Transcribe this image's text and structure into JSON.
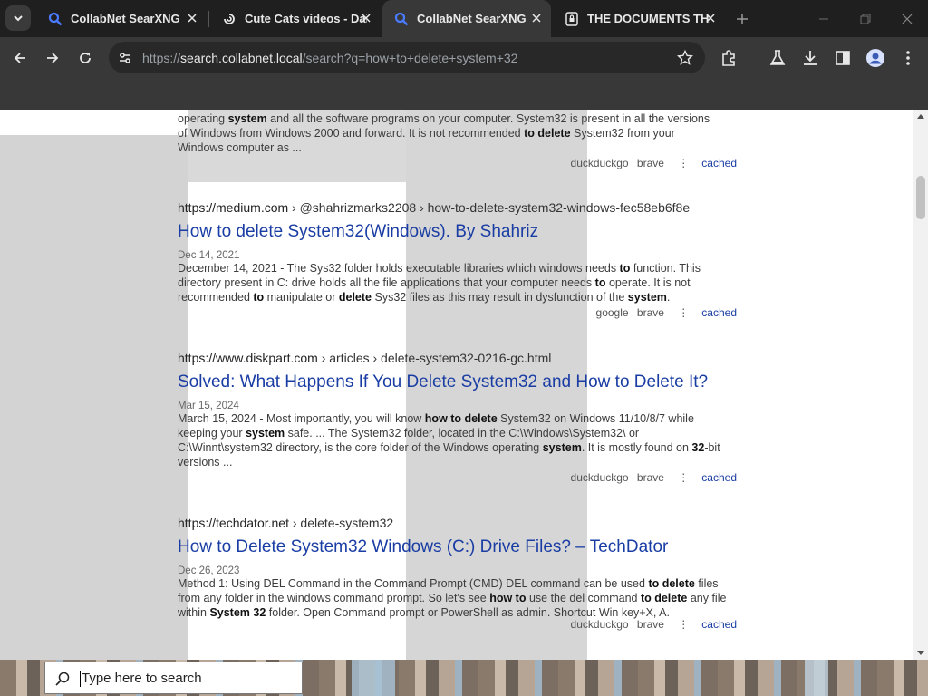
{
  "tabs": [
    {
      "title": "CollabNet SearXNG",
      "favicon": "magnifier-icon"
    },
    {
      "title": "Cute Cats videos - Dai",
      "favicon": "dailymotion-icon"
    },
    {
      "title": "CollabNet SearXNG",
      "favicon": "magnifier-icon",
      "active": true
    },
    {
      "title": "THE DOCUMENTS THA",
      "favicon": "lock-page-icon"
    }
  ],
  "address_bar": {
    "prefix": "https://",
    "host": "search.collabnet.local",
    "path": "/search?q=how+to+delete+system+32"
  },
  "results_fragment": {
    "l1_a": "operating ",
    "l1_b": "system",
    "l1_c": " and all the software programs on your computer. System32 is present in all the versions",
    "l2_a": "of Windows from Windows 2000 and forward. It is not recommended ",
    "l2_b": "to delete",
    "l2_c": " System32 from your",
    "l3": "Windows computer as ...",
    "engines": [
      "duckduckgo",
      "brave"
    ],
    "cached": "cached"
  },
  "results": [
    {
      "host": "https://medium.com",
      "path": " › @shahrizmarks2208 › how-to-delete-system32-windows-fec58eb6f8e",
      "title": "How to delete System32(Windows). By Shahriz",
      "date": "Dec 14, 2021",
      "engines": [
        "google",
        "brave"
      ],
      "cached": "cached"
    },
    {
      "host": "https://www.diskpart.com",
      "path": " › articles › delete-system32-0216-gc.html",
      "title": "Solved: What Happens If You Delete System32 and How to Delete It?",
      "date": "Mar 15, 2024",
      "engines": [
        "duckduckgo",
        "brave"
      ],
      "cached": "cached"
    },
    {
      "host": "https://techdator.net",
      "path": " › delete-system32",
      "title": "How to Delete System32 Windows (C:) Drive Files? – TechDator",
      "date": "Dec 26, 2023",
      "engines": [
        "duckduckgo",
        "brave"
      ],
      "cached": "cached"
    }
  ],
  "snippets": {
    "r1": [
      {
        "t": "December 14, 2021 - The Sys32 folder holds executable libraries which windows needs "
      },
      {
        "t": "to",
        "b": true
      },
      {
        "t": " function. This directory present in C: drive holds all the file applications that your computer needs "
      },
      {
        "t": "to",
        "b": true
      },
      {
        "t": " operate. It is not recommended "
      },
      {
        "t": "to",
        "b": true
      },
      {
        "t": " manipulate or "
      },
      {
        "t": "delete",
        "b": true
      },
      {
        "t": " Sys32 files as this may result in dysfunction of the "
      },
      {
        "t": "system",
        "b": true
      },
      {
        "t": "."
      }
    ],
    "r2": [
      {
        "t": "March 15, 2024 - Most importantly, you will know "
      },
      {
        "t": "how to delete",
        "b": true
      },
      {
        "t": " System32 on Windows 11/10/8/7 while keeping your "
      },
      {
        "t": "system",
        "b": true
      },
      {
        "t": " safe. ... The System32 folder, located in the C:\\Windows\\System32\\ or C:\\Winnt\\system32 directory, is the core folder of the Windows operating "
      },
      {
        "t": "system",
        "b": true
      },
      {
        "t": ". It is mostly found on "
      },
      {
        "t": "32",
        "b": true
      },
      {
        "t": "-bit versions ..."
      }
    ],
    "r3": [
      {
        "t": "Method 1: Using DEL Command in the Command Prompt (CMD) DEL command can be used "
      },
      {
        "t": "to delete",
        "b": true
      },
      {
        "t": " files from any folder in the windows command prompt. So let's see "
      },
      {
        "t": "how to",
        "b": true
      },
      {
        "t": " use the del command "
      },
      {
        "t": "to delete",
        "b": true
      },
      {
        "t": " any file within "
      },
      {
        "t": "System 32",
        "b": true
      },
      {
        "t": " folder. Open Command prompt or PowerShell as admin. Shortcut Win key+X, A."
      }
    ]
  },
  "taskbar": {
    "search_placeholder": "Type here to search"
  },
  "colors": {
    "link": "#1a3da4",
    "chrome_dark": "#1f1f1f",
    "chrome_mid": "#383838"
  }
}
